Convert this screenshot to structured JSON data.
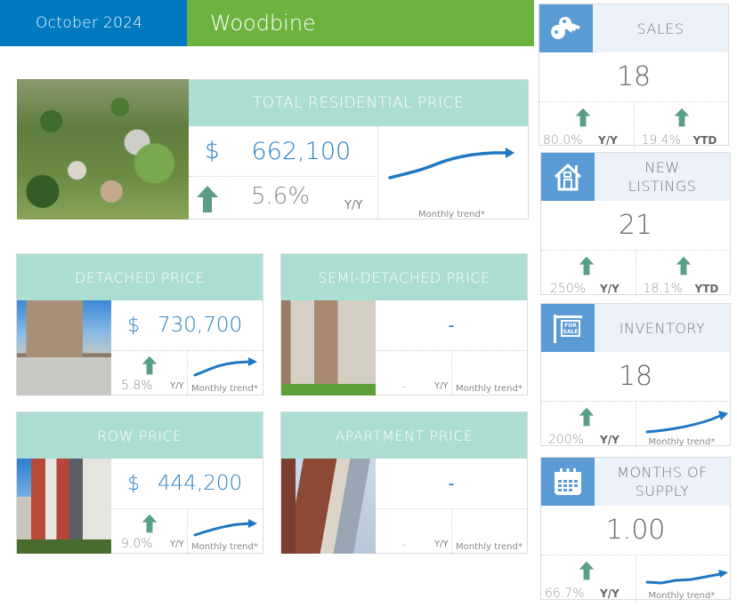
{
  "header": {
    "month": "October 2024",
    "area": "Woodbine"
  },
  "total": {
    "title": "TOTAL RESIDENTIAL PRICE",
    "currency": "$",
    "value": "662,100",
    "change": "5.6%",
    "change_label": "Y/Y",
    "trend_label": "Monthly trend*",
    "direction": "up"
  },
  "segments": [
    {
      "title": "DETACHED PRICE",
      "currency": "$",
      "value": "730,700",
      "change": "5.8%",
      "change_label": "Y/Y",
      "trend_label": "Monthly trend*",
      "has_trend": true
    },
    {
      "title": "SEMI-DETACHED PRICE",
      "currency": "",
      "value": "-",
      "change": "-",
      "change_label": "Y/Y",
      "trend_label": "Monthly trend*",
      "has_trend": false
    },
    {
      "title": "ROW PRICE",
      "currency": "$",
      "value": "444,200",
      "change": "9.0%",
      "change_label": "Y/Y",
      "trend_label": "Monthly trend*",
      "has_trend": true
    },
    {
      "title": "APARTMENT PRICE",
      "currency": "",
      "value": "-",
      "change": "-",
      "change_label": "Y/Y",
      "trend_label": "Monthly trend*",
      "has_trend": false
    }
  ],
  "stats": [
    {
      "title": "SALES",
      "icon": "keys-icon",
      "value": "18",
      "left_pct": "80.0%",
      "left_label": "Y/Y",
      "right_pct": "19.4%",
      "right_label": "YTD"
    },
    {
      "title": "NEW LISTINGS",
      "title_l1": "NEW",
      "title_l2": "LISTINGS",
      "icon": "house-icon",
      "value": "21",
      "left_pct": "250%",
      "left_label": "Y/Y",
      "right_pct": "18.1%",
      "right_label": "YTD"
    },
    {
      "title": "INVENTORY",
      "icon": "for-sale-sign-icon",
      "value": "18",
      "left_pct": "200%",
      "left_label": "Y/Y",
      "trend_label": "Monthly trend*"
    },
    {
      "title": "MONTHS OF SUPPLY",
      "title_l1": "MONTHS OF",
      "title_l2": "SUPPLY",
      "icon": "calendar-icon",
      "value": "1.00",
      "left_pct": "66.7%",
      "left_label": "Y/Y",
      "trend_label": "Monthly trend*"
    }
  ],
  "colors": {
    "blue": "#0079c1",
    "green": "#6db33f",
    "teal": "#acddd2",
    "arrow_up": "#5a9e86",
    "trend": "#1f78c1",
    "icon_bg": "#5b9bd5"
  }
}
